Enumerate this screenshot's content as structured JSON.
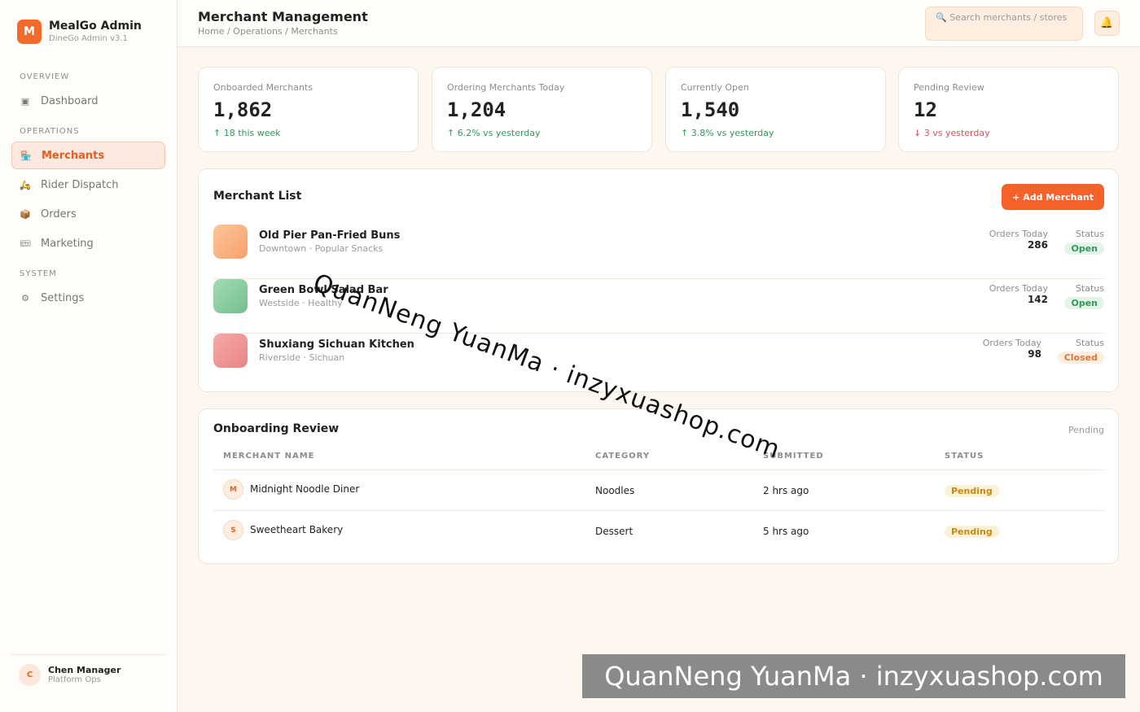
{
  "brand": {
    "logo": "M",
    "name": "MealGo Admin",
    "version": "DineGo Admin v3.1"
  },
  "sidebar": {
    "sections": [
      "OVERVIEW",
      "OPERATIONS",
      "SYSTEM"
    ],
    "items": [
      {
        "label": "Dashboard",
        "icon": "▣"
      },
      {
        "label": "Merchants",
        "icon": "🏪"
      },
      {
        "label": "Rider Dispatch",
        "icon": "🛵"
      },
      {
        "label": "Orders",
        "icon": "📦"
      },
      {
        "label": "Marketing",
        "icon": "🎟"
      },
      {
        "label": "Settings",
        "icon": "⚙"
      }
    ]
  },
  "user": {
    "initial": "C",
    "name": "Chen Manager",
    "role": "Platform Ops"
  },
  "header": {
    "title": "Merchant Management",
    "breadcrumb": "Home / Operations / Merchants",
    "search_placeholder": "🔍 Search merchants / stores",
    "bell_icon": "🔔"
  },
  "stats": [
    {
      "label": "Onboarded Merchants",
      "value": "1,862",
      "delta": "↑ 18 this week",
      "trend": "up"
    },
    {
      "label": "Ordering Merchants Today",
      "value": "1,204",
      "delta": "↑ 6.2% vs yesterday",
      "trend": "up"
    },
    {
      "label": "Currently Open",
      "value": "1,540",
      "delta": "↑ 3.8% vs yesterday",
      "trend": "up"
    },
    {
      "label": "Pending Review",
      "value": "12",
      "delta": "↓ 3 vs yesterday",
      "trend": "down"
    }
  ],
  "merchant_list": {
    "title": "Merchant List",
    "add_button": "+ Add Merchant",
    "orders_label": "Orders Today",
    "status_label": "Status",
    "rows": [
      {
        "name": "Old Pier Pan-Fried Buns",
        "sub": "Downtown · Popular Snacks",
        "orders": "286",
        "status": "Open",
        "thumb_color": "#fbb98a"
      },
      {
        "name": "Green Bowl Salad Bar",
        "sub": "Westside · Healthy",
        "orders": "142",
        "status": "Open",
        "thumb_color": "#8fd0a3"
      },
      {
        "name": "Shuxiang Sichuan Kitchen",
        "sub": "Riverside · Sichuan",
        "orders": "98",
        "status": "Closed",
        "thumb_color": "#f19a9a"
      }
    ]
  },
  "review": {
    "title": "Onboarding Review",
    "tag": "Pending",
    "columns": [
      "MERCHANT NAME",
      "CATEGORY",
      "SUBMITTED",
      "STATUS"
    ],
    "rows": [
      {
        "initial": "M",
        "name": "Midnight Noodle Diner",
        "category": "Noodles",
        "submitted": "2 hrs ago",
        "status": "Pending"
      },
      {
        "initial": "S",
        "name": "Sweetheart Bakery",
        "category": "Dessert",
        "submitted": "5 hrs ago",
        "status": "Pending"
      }
    ]
  },
  "watermark": "QuanNeng YuanMa · inzyxuashop.com"
}
